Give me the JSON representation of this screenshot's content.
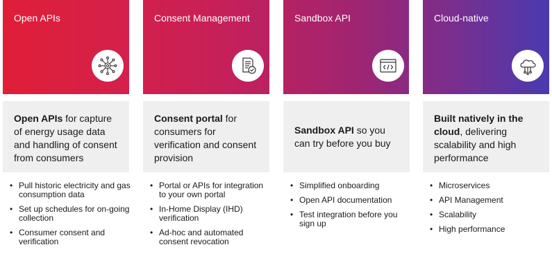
{
  "columns": [
    {
      "title": "Open APIs",
      "icon": "network-hub-icon",
      "summary_bold": "Open APIs",
      "summary_rest": " for capture of energy usage data and handling of consent from consumers",
      "bullets": [
        "Pull historic electricity and gas consumption data",
        "Set up schedules for on-going collection",
        "Consumer consent and verification"
      ]
    },
    {
      "title": "Consent Management",
      "icon": "document-check-icon",
      "summary_bold": "Consent portal",
      "summary_rest": " for consumers for verification and consent provision",
      "bullets": [
        "Portal or APIs for integration to your own portal",
        "In-Home Display (IHD) verification",
        "Ad-hoc and automated consent revocation"
      ]
    },
    {
      "title": "Sandbox API",
      "icon": "code-window-icon",
      "summary_bold": "Sandbox API",
      "summary_rest": " so you can try before you buy",
      "bullets": [
        "Simplified onboarding",
        "Open API documentation",
        "Test integration before you sign up"
      ]
    },
    {
      "title": "Cloud-native",
      "icon": "cloud-circuit-icon",
      "summary_bold": "Built natively in the cloud",
      "summary_rest": ", delivering scalability and high performance",
      "bullets": [
        "Microservices",
        "API Management",
        "Scalability",
        "High performance"
      ]
    }
  ]
}
